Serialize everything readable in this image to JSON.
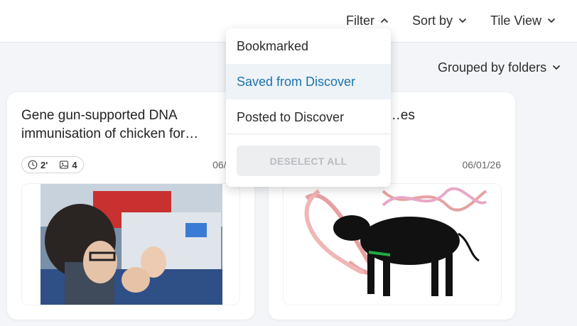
{
  "toolbar": {
    "filter_label": "Filter",
    "sort_label": "Sort by",
    "view_label": "Tile View"
  },
  "grouping": {
    "label": "Grouped by folders"
  },
  "filter_menu": {
    "items": [
      {
        "label": "Bookmarked"
      },
      {
        "label": "Saved from Discover"
      },
      {
        "label": "Posted to Discover"
      }
    ],
    "deselect_label": "DESELECT ALL"
  },
  "cards": [
    {
      "title": "Gene gun-supported DNA immunisation of chicken for…",
      "duration": "2'",
      "image_count": "4",
      "date": "06/01,"
    },
    {
      "title": "…als resistant to …es",
      "date": "06/01/26"
    }
  ],
  "colors": {
    "accent": "#1a73ad",
    "highlight_bg": "#eef3f8",
    "page_bg": "#f3f5f8"
  }
}
